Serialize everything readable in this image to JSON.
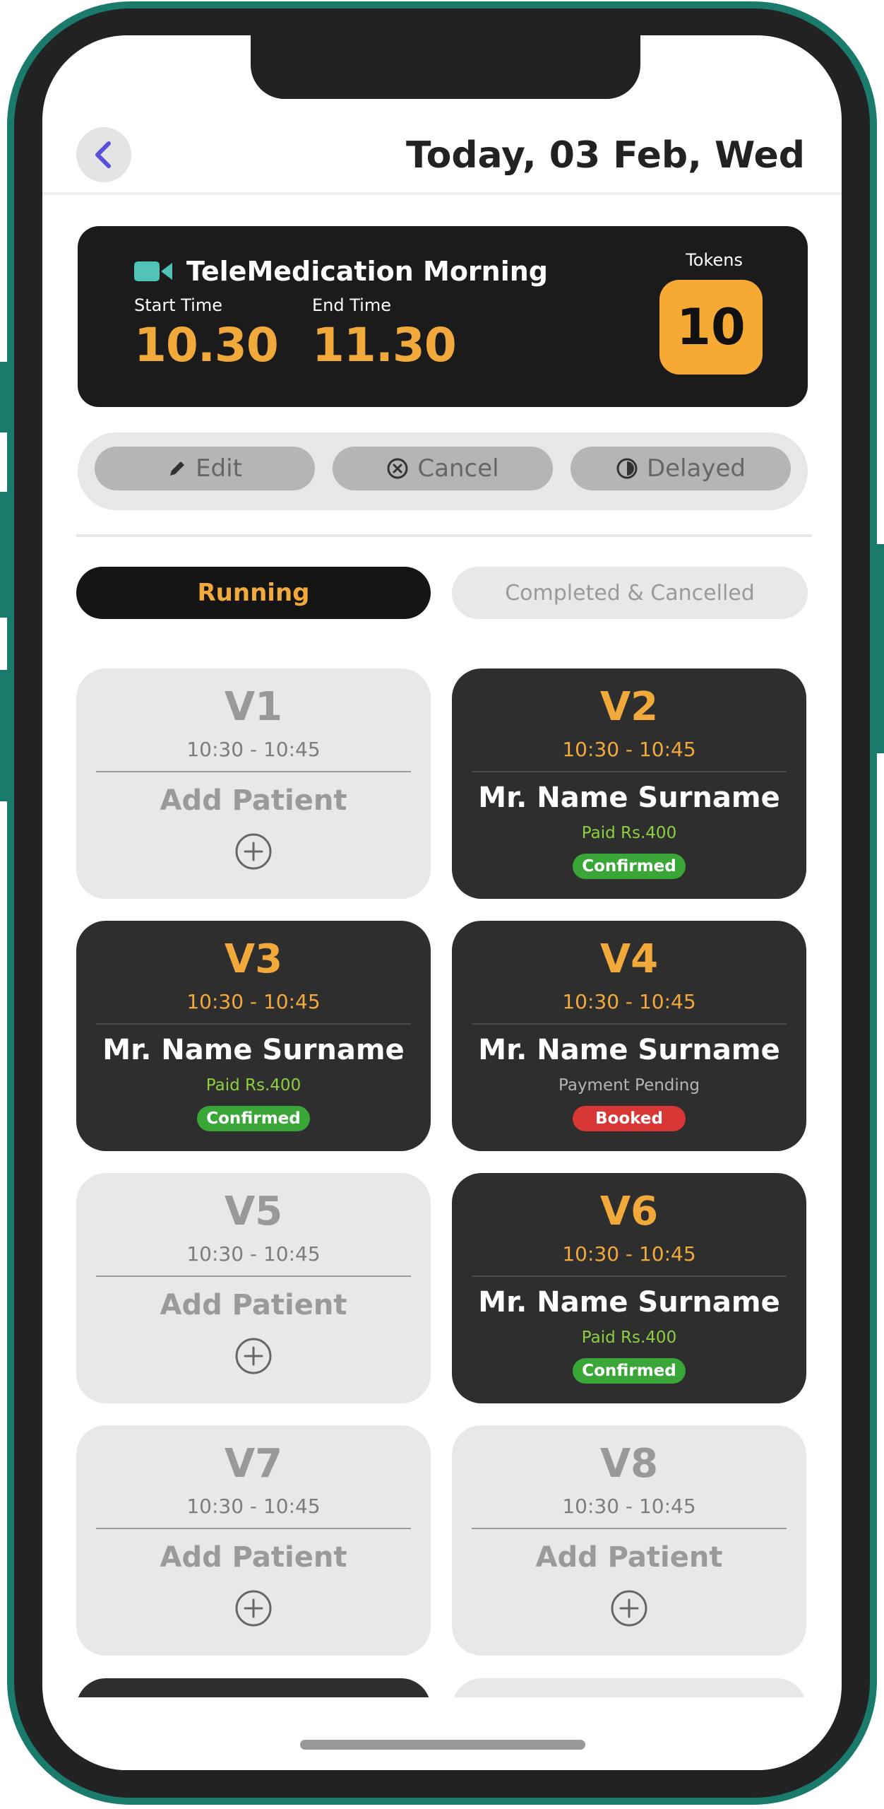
{
  "header": {
    "title": "Today, 03 Feb, Wed",
    "back_icon": "chevron-left-icon",
    "back_color": "#5a4fd8"
  },
  "session": {
    "icon": "video-camera-icon",
    "title": "TeleMedication Morning",
    "start_label": "Start Time",
    "start_value": "10.30",
    "end_label": "End Time",
    "end_value": "11.30",
    "tokens_label": "Tokens",
    "tokens_value": "10",
    "accent_color": "#f2a93b"
  },
  "actions": {
    "edit": {
      "label": "Edit",
      "icon": "pencil-icon"
    },
    "cancel": {
      "label": "Cancel",
      "icon": "x-circle-icon"
    },
    "delayed": {
      "label": "Delayed",
      "icon": "half-clock-icon"
    }
  },
  "tabs": {
    "running": "Running",
    "completed": "Completed & Cancelled",
    "active": "running"
  },
  "slots": [
    {
      "code": "V1",
      "time": "10:30 - 10:45",
      "state": "empty",
      "add_label": "Add Patient"
    },
    {
      "code": "V2",
      "time": "10:30 - 10:45",
      "state": "filled",
      "name": "Mr. Name Surname",
      "payment": "Paid Rs.400",
      "status": "Confirmed"
    },
    {
      "code": "V3",
      "time": "10:30 - 10:45",
      "state": "filled",
      "name": "Mr. Name Surname",
      "payment": "Paid Rs.400",
      "status": "Confirmed"
    },
    {
      "code": "V4",
      "time": "10:30 - 10:45",
      "state": "filled",
      "name": "Mr. Name Surname",
      "payment": "Payment Pending",
      "status": "Booked"
    },
    {
      "code": "V5",
      "time": "10:30 - 10:45",
      "state": "empty",
      "add_label": "Add Patient"
    },
    {
      "code": "V6",
      "time": "10:30 - 10:45",
      "state": "filled",
      "name": "Mr. Name Surname",
      "payment": "Paid Rs.400",
      "status": "Confirmed"
    },
    {
      "code": "V7",
      "time": "10:30 - 10:45",
      "state": "empty",
      "add_label": "Add Patient"
    },
    {
      "code": "V8",
      "time": "10:30 - 10:45",
      "state": "empty",
      "add_label": "Add Patient"
    }
  ],
  "colors": {
    "frame": "#1a7a6c",
    "confirmed": "#3aa637",
    "booked": "#d93636",
    "paid": "#8ccf3f"
  }
}
